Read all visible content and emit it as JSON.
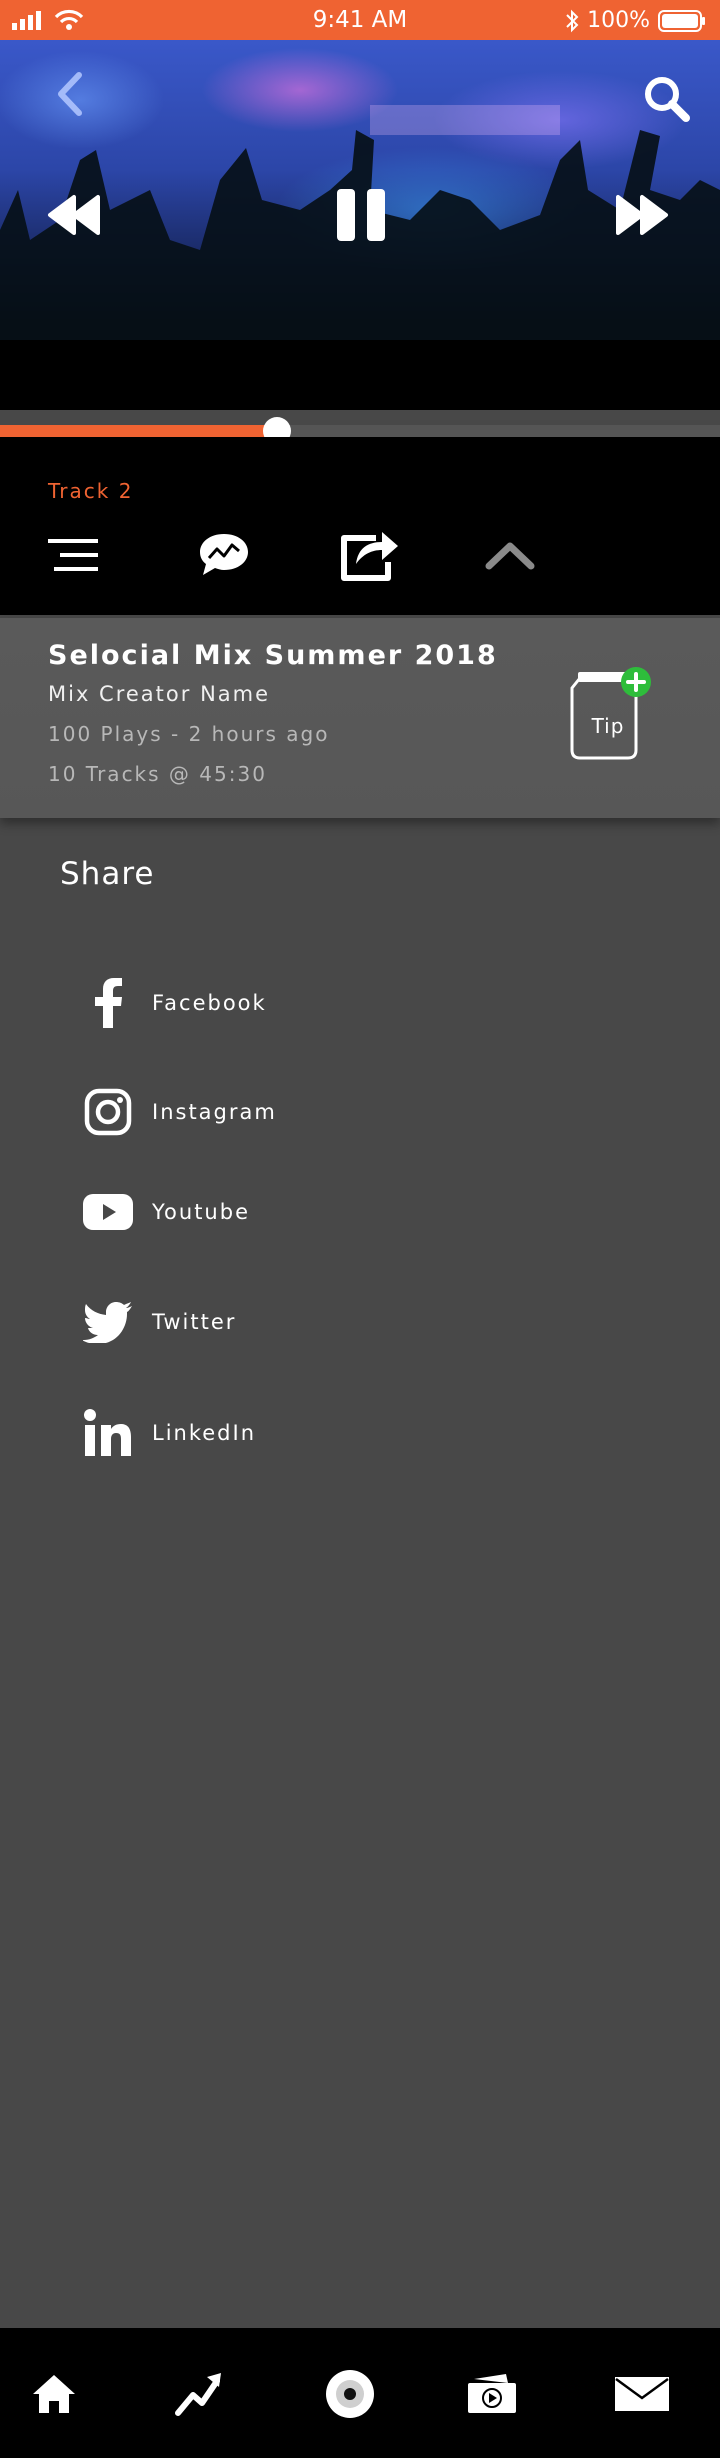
{
  "status_bar": {
    "time": "9:41 AM",
    "battery": "100%"
  },
  "player": {
    "progress_fraction": 0.385,
    "track_label": "Track 2"
  },
  "mix": {
    "title": "Selocial Mix Summer 2018",
    "creator": "Mix Creator Name",
    "plays": "100 Plays - 2 hours ago",
    "tracks": "10 Tracks @ 45:30",
    "tip_label": "Tip"
  },
  "share": {
    "title": "Share",
    "items": [
      {
        "label": "Facebook",
        "icon": "facebook-icon"
      },
      {
        "label": "Instagram",
        "icon": "instagram-icon"
      },
      {
        "label": "Youtube",
        "icon": "youtube-icon"
      },
      {
        "label": "Twitter",
        "icon": "twitter-icon"
      },
      {
        "label": "LinkedIn",
        "icon": "linkedin-icon"
      }
    ]
  },
  "colors": {
    "accent": "#ef6332",
    "background": "#484848",
    "tip_badge": "#2ebd3b"
  },
  "bottom_nav": [
    "home-icon",
    "trending-icon",
    "record-icon",
    "videos-icon",
    "mail-icon"
  ]
}
